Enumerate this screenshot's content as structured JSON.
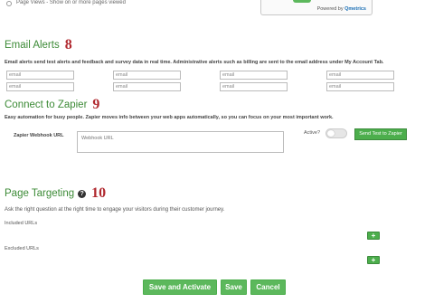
{
  "top": {
    "page_views_text": "Page Views - Show on    or more pages viewed",
    "powered_prefix": "Powered by",
    "powered_brand": "Qmetrics"
  },
  "email_alerts": {
    "title": "Email Alerts",
    "number": "8",
    "description": "Email alerts send test alerts and feedback and survey data in real time. Administrative alerts such as billing are sent to the email address under My Account Tab.",
    "row1": [
      "email",
      "email",
      "email",
      "email"
    ],
    "row2": [
      "email",
      "email",
      "email",
      "email"
    ]
  },
  "zapier": {
    "title": "Connect to Zapier",
    "number": "9",
    "description": "Easy automation for busy people. Zapier moves info between your web apps automatically, so you can focus on your most important work.",
    "webhook_label": "Zapier Webhook URL",
    "webhook_placeholder": "Webhook URL",
    "active_label": "Active?",
    "send_button": "Send Test to Zapier"
  },
  "page_targeting": {
    "title": "Page Targeting",
    "number": "10",
    "description": "Ask the right question at the right time to engage your visitors during their customer journey.",
    "included_label": "Included URLs",
    "excluded_label": "Excluded URLs",
    "add_symbol": "+"
  },
  "footer": {
    "save_activate": "Save and Activate",
    "save": "Save",
    "cancel": "Cancel"
  }
}
